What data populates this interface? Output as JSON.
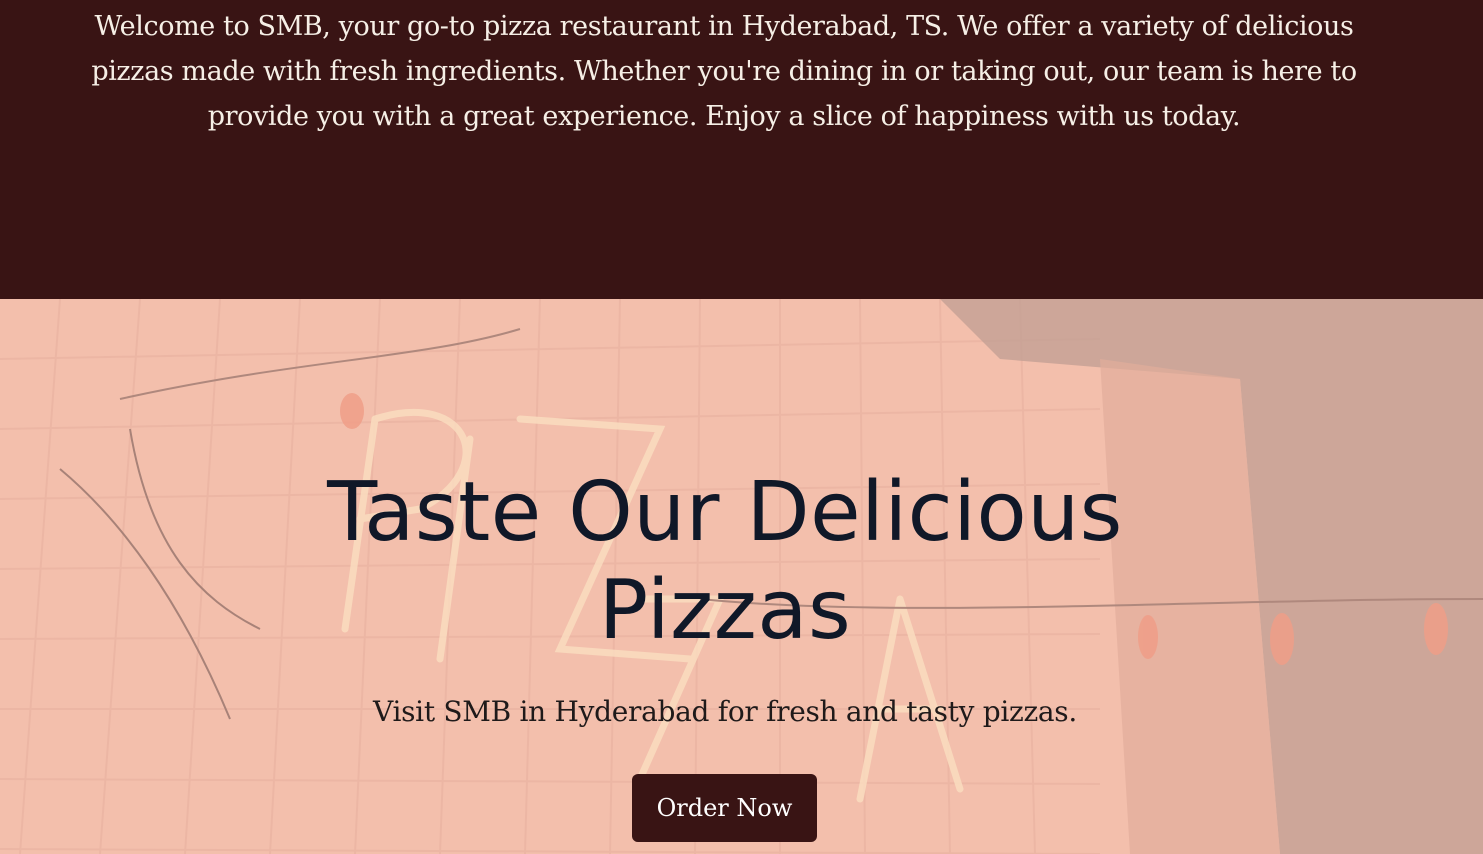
{
  "intro": {
    "text": "Welcome to SMB, your go-to pizza restaurant in Hyderabad, TS. We offer a variety of delicious pizzas made with fresh ingredients. Whether you're dining in or taking out, our team is here to provide you with a great experience. Enjoy a slice of happiness with us today."
  },
  "hero": {
    "title": "Taste Our Delicious Pizzas",
    "subtitle": "Visit SMB in Hyderabad for fresh and tasty pizzas.",
    "cta_label": "Order Now",
    "background_image": "neon-pizza-sign-photo"
  },
  "colors": {
    "brand_dark": "#391414",
    "hero_tint": "#f1c1ae",
    "heading": "#101828",
    "intro_text": "#f6efe6"
  }
}
